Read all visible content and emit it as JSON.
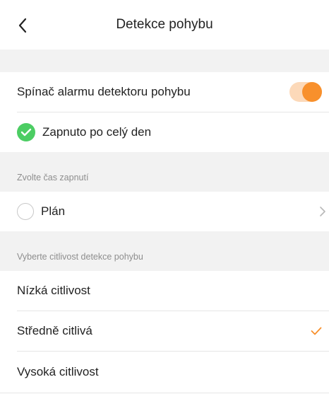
{
  "header": {
    "title": "Detekce pohybu",
    "back_icon": "chevron-left-icon"
  },
  "alarm": {
    "label": "Spínač alarmu detektoru pohybu",
    "enabled": true,
    "accent_color": "#f8902c"
  },
  "all_day": {
    "label": "Zapnuto po celý den",
    "selected": true,
    "icon": "green-check-circle-icon",
    "color": "#4ccd63"
  },
  "time_section": {
    "label": "Zvolte čas zapnutí"
  },
  "schedule": {
    "label": "Plán",
    "selected": false,
    "chevron_icon": "chevron-right-icon"
  },
  "sensitivity_section": {
    "label": "Vyberte citlivost detekce pohybu"
  },
  "sensitivity_options": [
    {
      "label": "Nízká citlivost",
      "selected": false
    },
    {
      "label": "Středně citlivá",
      "selected": true
    },
    {
      "label": "Vysoká citlivost",
      "selected": false
    }
  ]
}
